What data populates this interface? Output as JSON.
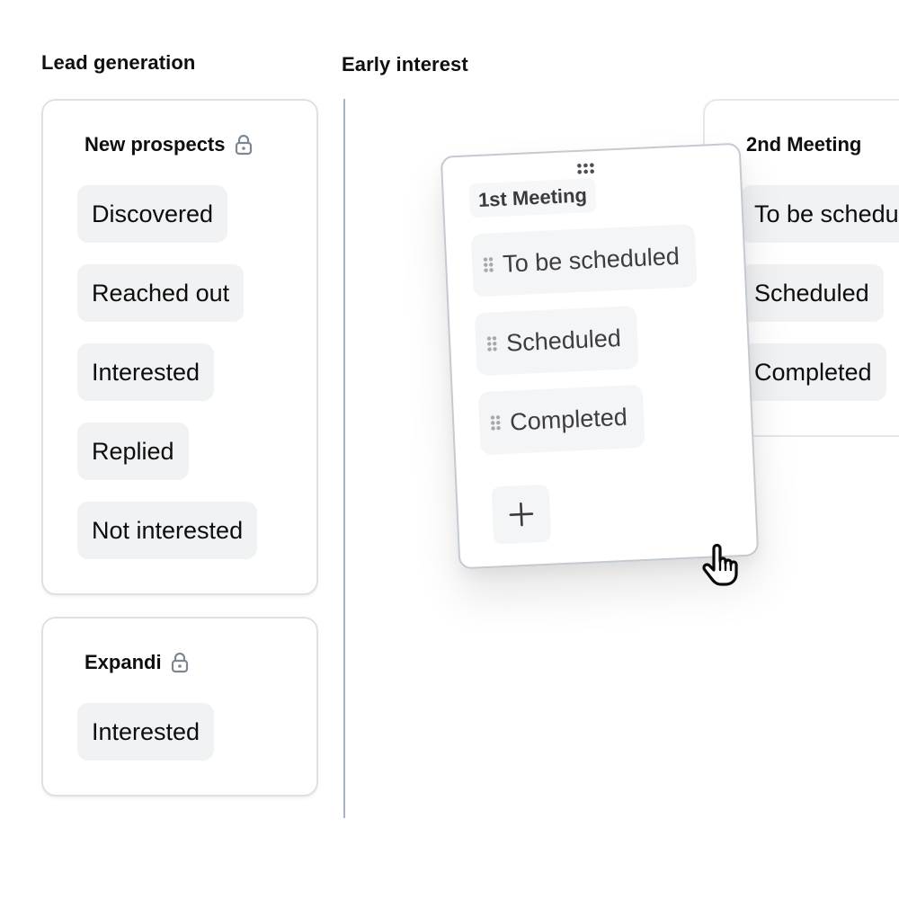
{
  "columns": [
    {
      "title": "Lead generation",
      "stages": [
        {
          "name": "New prospects",
          "locked": true,
          "icon": "lock-icon",
          "statuses": [
            "Discovered",
            "Reached out",
            "Interested",
            "Replied",
            "Not interested"
          ]
        },
        {
          "name": "Expandi",
          "locked": true,
          "icon": "lock-icon",
          "statuses": [
            "Interested"
          ]
        }
      ]
    },
    {
      "title": "Early interest",
      "stages": [
        {
          "name": "1st Meeting",
          "state": "dragging",
          "statuses": [
            "To be scheduled",
            "Scheduled",
            "Completed"
          ],
          "add_button": "+"
        },
        {
          "name": "2nd Meeting",
          "statuses": [
            "To be scheduled",
            "Scheduled",
            "Completed"
          ]
        }
      ]
    }
  ],
  "cursor": "grab-hand-icon",
  "colors": {
    "chip_bg": "#f1f2f4",
    "card_border": "#dde1e6",
    "divider": "#a9b3be",
    "icon_gray": "#7d8792"
  }
}
